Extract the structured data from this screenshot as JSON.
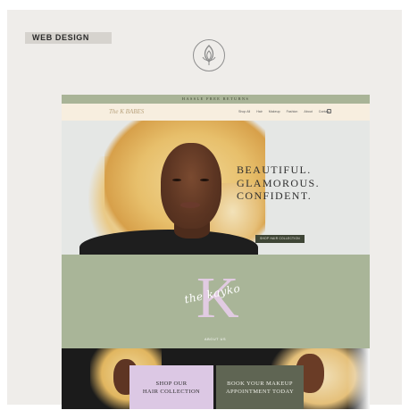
{
  "badge": {
    "label": "WEB DESIGN"
  },
  "logo": {
    "icon": "lotus-leaf-icon"
  },
  "site": {
    "topbar": {
      "text": "HASSLE FREE RETURNS"
    },
    "brand": {
      "name": "The K BABES"
    },
    "nav": {
      "items": [
        {
          "label": "Shop All"
        },
        {
          "label": "Hair"
        },
        {
          "label": "Makeup"
        },
        {
          "label": "Fashion"
        },
        {
          "label": "About"
        },
        {
          "label": "Contact"
        }
      ],
      "cart_icon": "cart-icon"
    },
    "hero": {
      "title_lines": [
        "BEAUTIFUL.",
        "GLAMOROUS.",
        "CONFIDENT."
      ],
      "cta": "SHOP HAIR COLLECTION"
    },
    "about": {
      "letter": "K",
      "script": "the kayko",
      "link": "ABOUT US"
    },
    "bottom": {
      "shop_lines": [
        "SHOP OUR",
        "HAIR COLLECTION"
      ],
      "book_lines": [
        "BOOK YOUR MAKEUP",
        "APPOINTMENT TODAY"
      ]
    }
  },
  "colors": {
    "sage": "#a9b598",
    "lavender": "#dcc8e4",
    "olive_dark": "#5f6553",
    "cream": "#f7eedf"
  }
}
